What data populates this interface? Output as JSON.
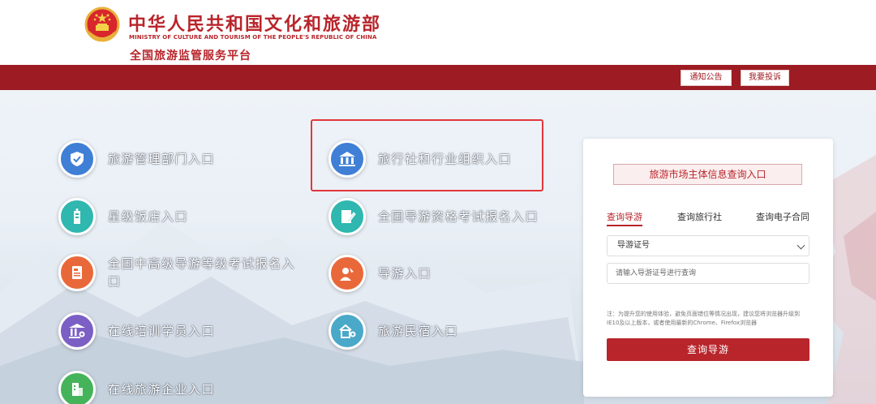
{
  "header": {
    "title_cn": "中华人民共和国文化和旅游部",
    "title_en": "MINISTRY OF CULTURE AND TOURISM OF THE PEOPLE'S REPUBLIC OF CHINA",
    "subtitle": "全国旅游监管服务平台"
  },
  "topbar": {
    "notice_label": "通知公告",
    "complaint_label": "我要投诉"
  },
  "entries": [
    {
      "label": "旅游管理部门入口",
      "icon": "shield-icon",
      "color": "#3f7fd6"
    },
    {
      "label": "旅行社和行业组织入口",
      "icon": "building-icon",
      "color": "#3f7fd6"
    },
    {
      "label": "星级饭店入口",
      "icon": "hotel-icon",
      "color": "#2fb7b0"
    },
    {
      "label": "全国导游资格考试报名入口",
      "icon": "document-edit-icon",
      "color": "#2fb7b0"
    },
    {
      "label": "全国中高级导游等级考试报名入口",
      "icon": "exam-doc-icon",
      "color": "#e9683a"
    },
    {
      "label": "导游入口",
      "icon": "guide-icon",
      "color": "#e9683a"
    },
    {
      "label": "在线培训学员入口",
      "icon": "training-icon",
      "color": "#7b5fc4"
    },
    {
      "label": "旅游民宿入口",
      "icon": "homestay-icon",
      "color": "#4aa8c8"
    },
    {
      "label": "在线旅游企业入口",
      "icon": "enterprise-icon",
      "color": "#45b35a"
    }
  ],
  "panel": {
    "title": "旅游市场主体信息查询入口",
    "tabs": [
      "查询导游",
      "查询旅行社",
      "查询电子合同"
    ],
    "active_tab": 0,
    "select_value": "导游证号",
    "input_placeholder": "请输入导游证号进行查询",
    "note": "注：为提升您的使用体验，避免页面错位等情况出现，建议您将浏览器升级到IE10及以上版本，或者使用最新的Chrome、Firefox浏览器",
    "search_label": "查询导游",
    "accent": "#b8252b"
  },
  "colors": {
    "brand_red": "#b8252b",
    "bar_red": "#9d1b22"
  }
}
